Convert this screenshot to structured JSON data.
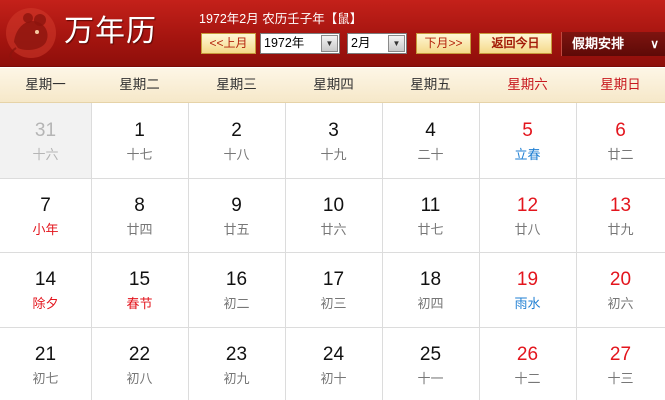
{
  "header": {
    "app_title": "万年历",
    "info_line": "1972年2月 农历壬子年【鼠】",
    "prev_month_label": "<<上月",
    "year_select_value": "1972年",
    "month_select_value": "2月",
    "next_month_label": "下月>>",
    "today_label": "返回今日",
    "holiday_label": "假期安排",
    "holiday_chevron": "∨"
  },
  "colors": {
    "header_red": "#a3140f",
    "weekend_red": "#e3151d",
    "solar_term_blue": "#1f7fd3",
    "lunar_gray": "#777777"
  },
  "weekdays": [
    "星期一",
    "星期二",
    "星期三",
    "星期四",
    "星期五",
    "星期六",
    "星期日"
  ],
  "weeks": [
    [
      {
        "day": "31",
        "lunar": "十六",
        "kind": "normal",
        "other": true
      },
      {
        "day": "1",
        "lunar": "十七",
        "kind": "normal"
      },
      {
        "day": "2",
        "lunar": "十八",
        "kind": "normal"
      },
      {
        "day": "3",
        "lunar": "十九",
        "kind": "normal"
      },
      {
        "day": "4",
        "lunar": "二十",
        "kind": "normal"
      },
      {
        "day": "5",
        "lunar": "立春",
        "kind": "term"
      },
      {
        "day": "6",
        "lunar": "廿二",
        "kind": "normal"
      }
    ],
    [
      {
        "day": "7",
        "lunar": "小年",
        "kind": "festival"
      },
      {
        "day": "8",
        "lunar": "廿四",
        "kind": "normal"
      },
      {
        "day": "9",
        "lunar": "廿五",
        "kind": "normal"
      },
      {
        "day": "10",
        "lunar": "廿六",
        "kind": "normal"
      },
      {
        "day": "11",
        "lunar": "廿七",
        "kind": "normal"
      },
      {
        "day": "12",
        "lunar": "廿八",
        "kind": "normal"
      },
      {
        "day": "13",
        "lunar": "廿九",
        "kind": "normal"
      }
    ],
    [
      {
        "day": "14",
        "lunar": "除夕",
        "kind": "festival"
      },
      {
        "day": "15",
        "lunar": "春节",
        "kind": "festival"
      },
      {
        "day": "16",
        "lunar": "初二",
        "kind": "normal"
      },
      {
        "day": "17",
        "lunar": "初三",
        "kind": "normal"
      },
      {
        "day": "18",
        "lunar": "初四",
        "kind": "normal"
      },
      {
        "day": "19",
        "lunar": "雨水",
        "kind": "term"
      },
      {
        "day": "20",
        "lunar": "初六",
        "kind": "normal"
      }
    ],
    [
      {
        "day": "21",
        "lunar": "初七",
        "kind": "normal"
      },
      {
        "day": "22",
        "lunar": "初八",
        "kind": "normal"
      },
      {
        "day": "23",
        "lunar": "初九",
        "kind": "normal"
      },
      {
        "day": "24",
        "lunar": "初十",
        "kind": "normal"
      },
      {
        "day": "25",
        "lunar": "十一",
        "kind": "normal"
      },
      {
        "day": "26",
        "lunar": "十二",
        "kind": "normal"
      },
      {
        "day": "27",
        "lunar": "十三",
        "kind": "normal"
      }
    ]
  ]
}
